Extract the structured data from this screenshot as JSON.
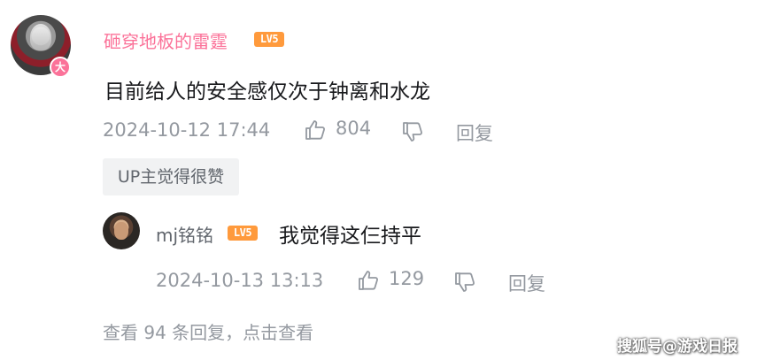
{
  "comment": {
    "username": "砸穿地板的雷霆",
    "level": "LV5",
    "avatar_badge": "大",
    "text": "目前给人的安全感仅次于钟离和水龙",
    "time": "2024-10-12 17:44",
    "like_count": "804",
    "reply_label": "回复",
    "up_tag": "UP主觉得很赞"
  },
  "reply": {
    "username": "mj铭铭",
    "level": "LV5",
    "text": "我觉得这仨持平",
    "time": "2024-10-13 13:13",
    "like_count": "129",
    "reply_label": "回复"
  },
  "view_more": "查看 94 条回复，点击查看",
  "watermark": "搜狐号@游戏日报",
  "colors": {
    "username_vip": "#fb7299",
    "level_badge": "#ff9a3c",
    "meta_gray": "#9499a0",
    "tag_bg": "#f1f2f3"
  },
  "icons": {
    "like": "thumbs-up-icon",
    "dislike": "thumbs-down-icon"
  }
}
